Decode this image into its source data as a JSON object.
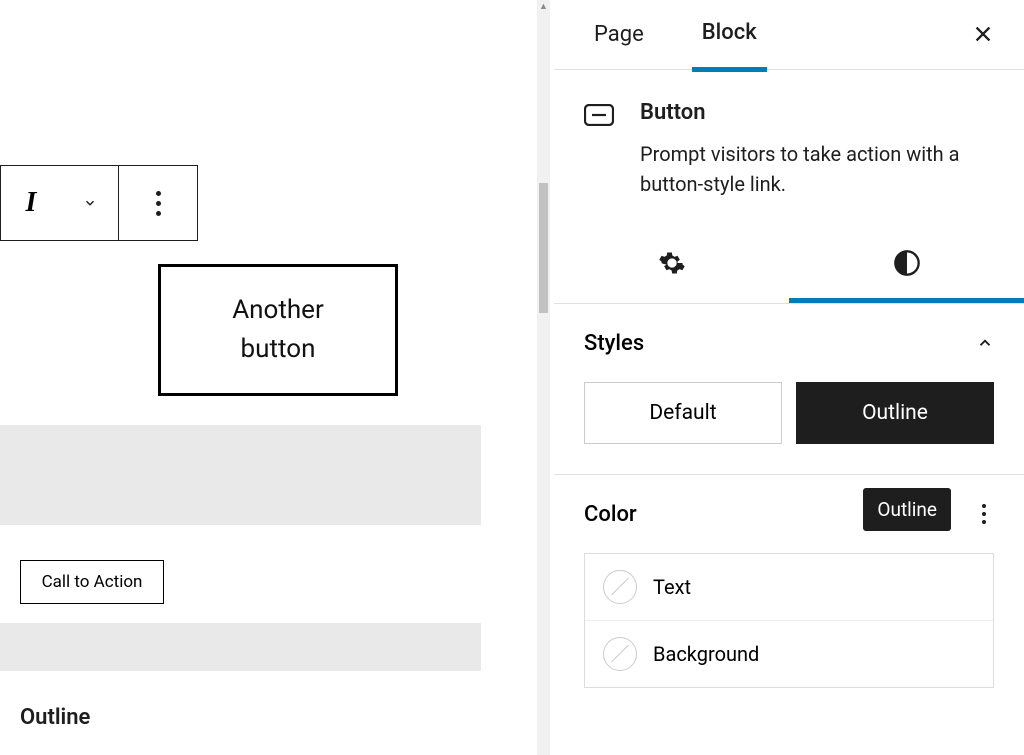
{
  "editor": {
    "outline_button_line1": "Another",
    "outline_button_line2": "button",
    "cta_label": "Call to Action",
    "section_label": "Outline"
  },
  "sidebar": {
    "tabs": {
      "page": "Page",
      "block": "Block"
    },
    "block": {
      "name": "Button",
      "description": "Prompt visitors to take action with a button-style link."
    },
    "styles": {
      "heading": "Styles",
      "default": "Default",
      "outline": "Outline",
      "tooltip": "Outline"
    },
    "color": {
      "heading": "Color",
      "text": "Text",
      "background": "Background"
    }
  }
}
